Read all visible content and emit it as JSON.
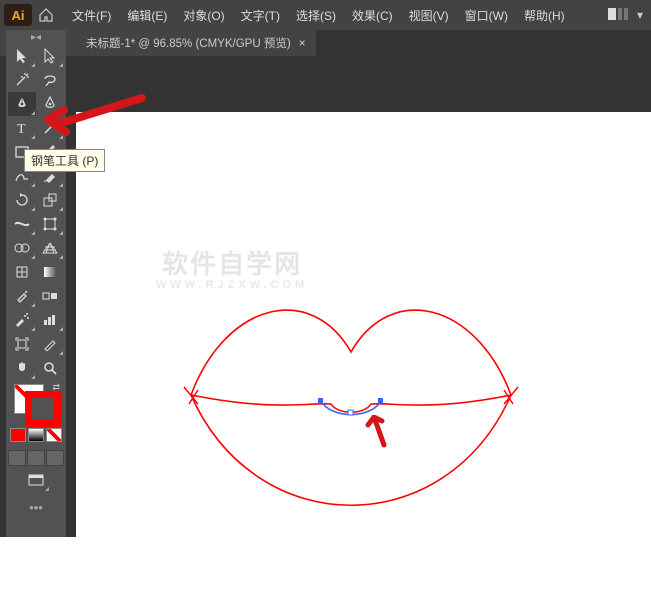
{
  "app": {
    "name": "Ai"
  },
  "menu": {
    "items": [
      "文件(F)",
      "编辑(E)",
      "对象(O)",
      "文字(T)",
      "选择(S)",
      "效果(C)",
      "视图(V)",
      "窗口(W)",
      "帮助(H)"
    ]
  },
  "tab": {
    "title": "未标题-1* @ 96.85%  (CMYK/GPU 预览)",
    "close": "×"
  },
  "tooltip": {
    "pen": "钢笔工具 (P)"
  },
  "watermark": {
    "line1": "软件自学网",
    "line2": "WWW.RJZXW.COM"
  },
  "colors": {
    "accent": "#f6a623",
    "stroke": "#ff0000",
    "anchor": "#3366ff"
  }
}
